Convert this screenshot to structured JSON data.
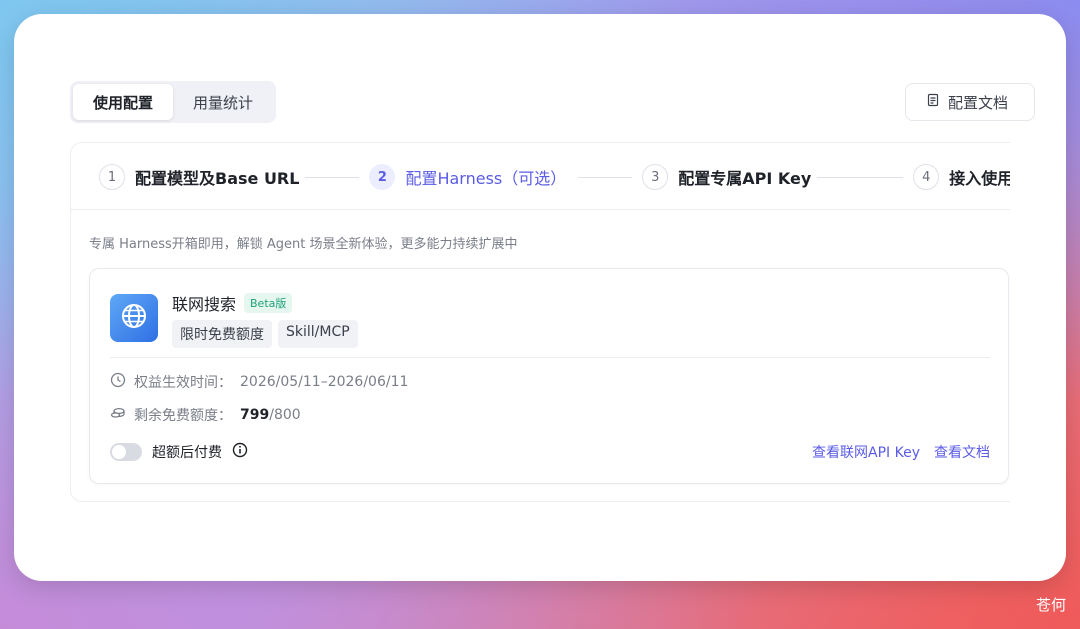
{
  "tabs": [
    {
      "label": "使用配置",
      "active": true
    },
    {
      "label": "用量统计",
      "active": false
    }
  ],
  "doc_button": {
    "label": "配置文档",
    "icon": "document-icon"
  },
  "steps": [
    {
      "num": "1",
      "label": "配置模型及Base URL"
    },
    {
      "num": "2",
      "label": "配置Harness（可选）"
    },
    {
      "num": "3",
      "label": "配置专属API Key"
    },
    {
      "num": "4",
      "label": "接入使用"
    }
  ],
  "description": "专属 Harness开箱即用，解锁 Agent 场景全新体验，更多能力持续扩展中",
  "feature": {
    "title": "联网搜索",
    "badge": "Beta版",
    "tags": [
      "限时免费额度",
      "Skill/MCP"
    ],
    "period_label": "权益生效时间：",
    "period_value": "2026/05/11–2026/06/11",
    "quota_label": "剩余免费额度：",
    "quota_used": "799",
    "quota_total": "/800",
    "toggle_label": "超额后付费",
    "toggle_on": false,
    "link_api_key": "查看联网API Key",
    "link_docs": "查看文档"
  },
  "watermark": "苍何",
  "colors": {
    "accent": "#5b5ce6",
    "beta": "#1fa37a"
  }
}
